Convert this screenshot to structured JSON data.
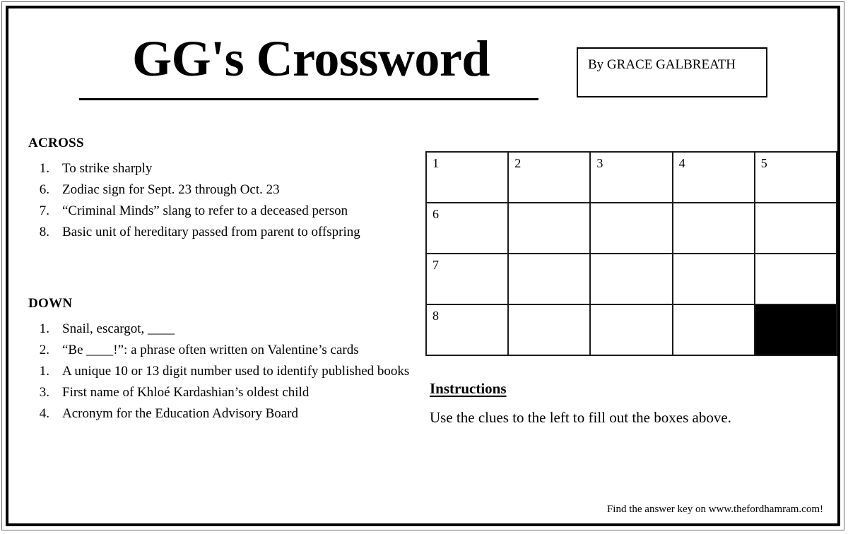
{
  "masthead": {
    "title": "GG's Crossword",
    "byline": "By GRACE GALBREATH"
  },
  "across": {
    "heading": "ACROSS",
    "clues": [
      {
        "number": "1.",
        "text": "To strike sharply"
      },
      {
        "number": "6.",
        "text": "Zodiac sign for Sept. 23 through Oct. 23"
      },
      {
        "number": "7.",
        "text": "“Criminal Minds” slang to refer to a deceased person"
      },
      {
        "number": "8.",
        "text": "Basic unit of hereditary passed from parent to offspring"
      }
    ]
  },
  "down": {
    "heading": "DOWN",
    "clues": [
      {
        "number": "1.",
        "text": "Snail, escargot, ____"
      },
      {
        "number": "2.",
        "text": "“Be ____!”: a phrase often written on Valentine’s cards"
      },
      {
        "number": "1.",
        "text": "A unique 10 or 13 digit number used to identify published books"
      },
      {
        "number": "3.",
        "text": "First name of Khloé Kardashian’s oldest child"
      },
      {
        "number": "4.",
        "text": "Acronym for the Education Advisory Board"
      }
    ]
  },
  "grid": {
    "columns": 5,
    "rows": 4,
    "cells": [
      [
        {
          "number": "1",
          "blocked": false
        },
        {
          "number": "2",
          "blocked": false
        },
        {
          "number": "3",
          "blocked": false
        },
        {
          "number": "4",
          "blocked": false
        },
        {
          "number": "5",
          "blocked": false
        }
      ],
      [
        {
          "number": "6",
          "blocked": false
        },
        {
          "number": "",
          "blocked": false
        },
        {
          "number": "",
          "blocked": false
        },
        {
          "number": "",
          "blocked": false
        },
        {
          "number": "",
          "blocked": false
        }
      ],
      [
        {
          "number": "7",
          "blocked": false
        },
        {
          "number": "",
          "blocked": false
        },
        {
          "number": "",
          "blocked": false
        },
        {
          "number": "",
          "blocked": false
        },
        {
          "number": "",
          "blocked": false
        }
      ],
      [
        {
          "number": "8",
          "blocked": false
        },
        {
          "number": "",
          "blocked": false
        },
        {
          "number": "",
          "blocked": false
        },
        {
          "number": "",
          "blocked": false
        },
        {
          "number": "",
          "blocked": true
        }
      ]
    ]
  },
  "instructions": {
    "heading": "Instructions",
    "body": "Use the clues to the left to fill out the boxes above."
  },
  "footer": {
    "text": "Find the answer key on www.thefordhamram.com!"
  },
  "colors": {
    "ink": "#000000",
    "paper": "#ffffff",
    "grid_line": "#1a1a1a"
  }
}
